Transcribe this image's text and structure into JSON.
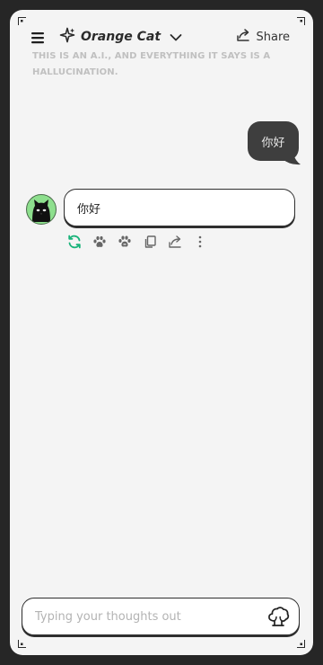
{
  "header": {
    "menu_icon": "hamburger-menu-icon",
    "model_icon": "sparkle-icon",
    "model_name": "Orange Cat",
    "model_dropdown_icon": "chevron-down-icon",
    "share_icon": "share-icon",
    "share_label": "Share"
  },
  "disclaimer": "THIS IS AN A.I., AND EVERYTHING IT SAYS IS A HALLUCINATION.",
  "messages": [
    {
      "role": "user",
      "text": "你好"
    },
    {
      "role": "assistant",
      "text": "你好",
      "avatar": "black-cat-avatar"
    }
  ],
  "message_actions": [
    {
      "icon": "regenerate-icon",
      "color": "#19b37a"
    },
    {
      "icon": "paw-thumbs-up-icon"
    },
    {
      "icon": "paw-thumbs-down-icon"
    },
    {
      "icon": "copy-icon"
    },
    {
      "icon": "share-icon"
    },
    {
      "icon": "more-vertical-icon"
    }
  ],
  "composer": {
    "placeholder": "Typing your thoughts out",
    "value": "",
    "send_icon": "tree-icon"
  },
  "colors": {
    "background": "#262626",
    "panel": "#f4f4f4",
    "user_bubble": "#3e3e3e",
    "accent_green": "#19b37a",
    "avatar_bg": "#8ddf8d"
  }
}
